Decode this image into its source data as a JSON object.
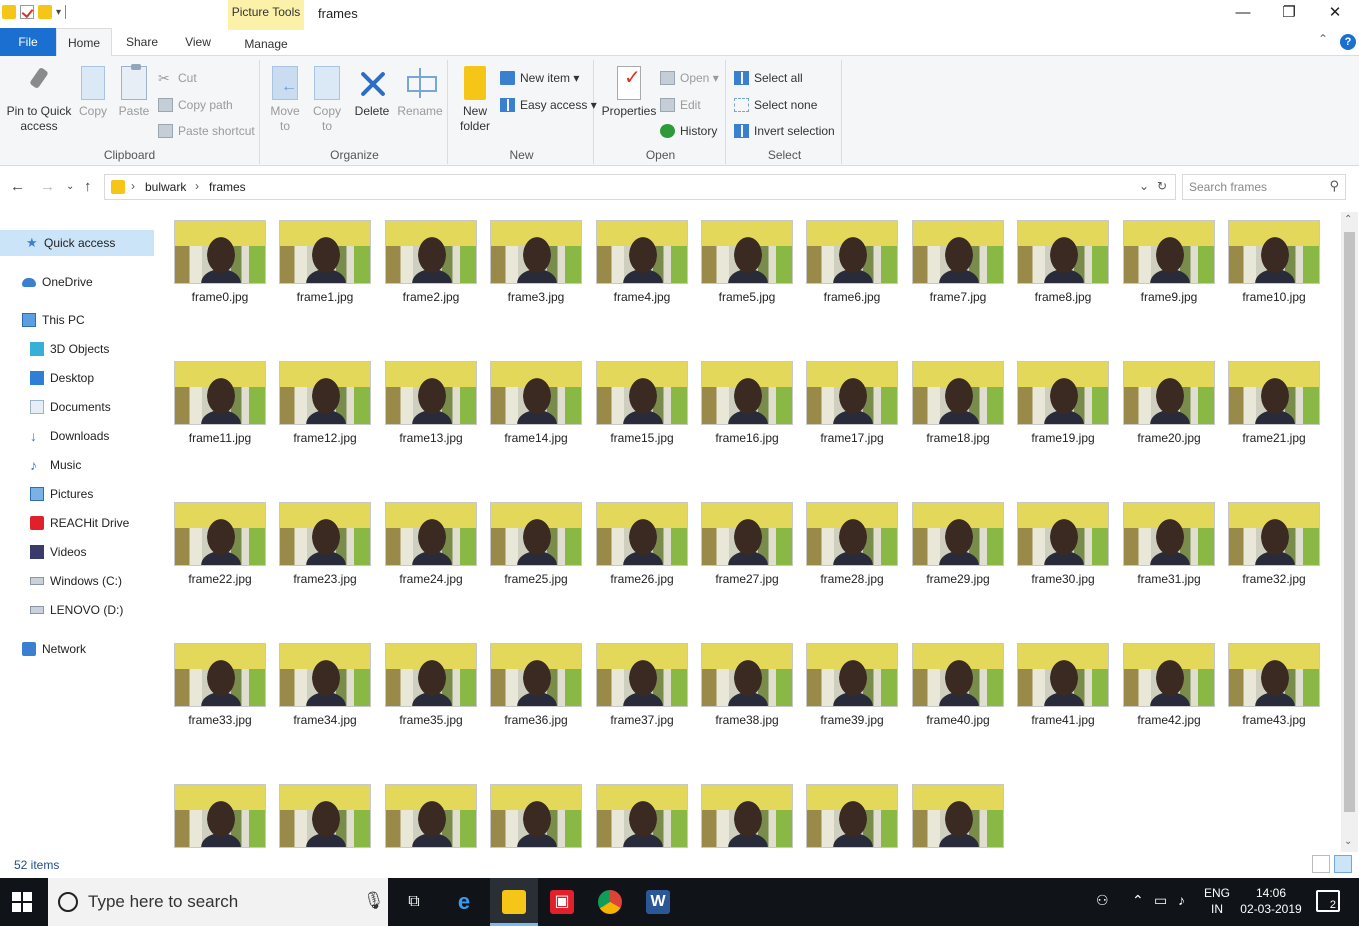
{
  "window": {
    "title": "frames",
    "contextual_tab_group": "Picture Tools",
    "controls": {
      "minimize": "—",
      "maximize": "❐",
      "close": "✕"
    }
  },
  "ribbon_tabs": [
    {
      "label": "File"
    },
    {
      "label": "Home"
    },
    {
      "label": "Share"
    },
    {
      "label": "View"
    },
    {
      "label": "Manage"
    }
  ],
  "ribbon": {
    "clipboard": {
      "label": "Clipboard",
      "pin": "Pin to Quick access",
      "copy": "Copy",
      "paste": "Paste",
      "cut": "Cut",
      "copy_path": "Copy path",
      "paste_shortcut": "Paste shortcut"
    },
    "organize": {
      "label": "Organize",
      "move_to": "Move to",
      "copy_to": "Copy to",
      "delete": "Delete",
      "rename": "Rename"
    },
    "new": {
      "label": "New",
      "new_folder": "New folder",
      "new_item": "New item ▾",
      "easy_access": "Easy access ▾"
    },
    "open": {
      "label": "Open",
      "properties": "Properties",
      "open": "Open ▾",
      "edit": "Edit",
      "history": "History"
    },
    "select": {
      "label": "Select",
      "select_all": "Select all",
      "select_none": "Select none",
      "invert_selection": "Invert selection"
    }
  },
  "address": {
    "crumbs": [
      "bulwark",
      "frames"
    ],
    "search_placeholder": "Search frames"
  },
  "nav_pane": [
    {
      "label": "Quick access",
      "icon": "star-icon",
      "level": 0,
      "selected": true
    },
    {
      "label": "OneDrive",
      "icon": "cloud-icon",
      "level": 0
    },
    {
      "label": "This PC",
      "icon": "computer-icon",
      "level": 0
    },
    {
      "label": "3D Objects",
      "icon": "cube-icon",
      "level": 1
    },
    {
      "label": "Desktop",
      "icon": "desktop-icon",
      "level": 1
    },
    {
      "label": "Documents",
      "icon": "document-icon",
      "level": 1
    },
    {
      "label": "Downloads",
      "icon": "download-icon",
      "level": 1
    },
    {
      "label": "Music",
      "icon": "music-icon",
      "level": 1
    },
    {
      "label": "Pictures",
      "icon": "pictures-icon",
      "level": 1
    },
    {
      "label": "REACHit Drive",
      "icon": "reachit-icon",
      "level": 1
    },
    {
      "label": "Videos",
      "icon": "video-icon",
      "level": 1
    },
    {
      "label": "Windows (C:)",
      "icon": "drive-icon",
      "level": 1
    },
    {
      "label": "LENOVO (D:)",
      "icon": "drive-icon",
      "level": 1
    },
    {
      "label": "Network",
      "icon": "network-icon",
      "level": 0
    }
  ],
  "files": [
    "frame0.jpg",
    "frame1.jpg",
    "frame2.jpg",
    "frame3.jpg",
    "frame4.jpg",
    "frame5.jpg",
    "frame6.jpg",
    "frame7.jpg",
    "frame8.jpg",
    "frame9.jpg",
    "frame10.jpg",
    "frame11.jpg",
    "frame12.jpg",
    "frame13.jpg",
    "frame14.jpg",
    "frame15.jpg",
    "frame16.jpg",
    "frame17.jpg",
    "frame18.jpg",
    "frame19.jpg",
    "frame20.jpg",
    "frame21.jpg",
    "frame22.jpg",
    "frame23.jpg",
    "frame24.jpg",
    "frame25.jpg",
    "frame26.jpg",
    "frame27.jpg",
    "frame28.jpg",
    "frame29.jpg",
    "frame30.jpg",
    "frame31.jpg",
    "frame32.jpg",
    "frame33.jpg",
    "frame34.jpg",
    "frame35.jpg",
    "frame36.jpg",
    "frame37.jpg",
    "frame38.jpg",
    "frame39.jpg",
    "frame40.jpg",
    "frame41.jpg",
    "frame42.jpg",
    "frame43.jpg"
  ],
  "partial_row_unlabeled_thumbnails": 8,
  "status": {
    "item_count": "52 items"
  },
  "taskbar": {
    "search_text": "Type here to search",
    "apps": [
      {
        "name": "task-view-icon"
      },
      {
        "name": "edge-icon"
      },
      {
        "name": "file-explorer-icon",
        "active": true
      },
      {
        "name": "reachit-app-icon"
      },
      {
        "name": "chrome-icon"
      },
      {
        "name": "word-icon"
      }
    ],
    "tray": {
      "lang_line1": "ENG",
      "lang_line2": "IN",
      "time": "14:06",
      "date": "02-03-2019",
      "notifications": "2"
    }
  },
  "colors": {
    "accent": "#1a6fd0",
    "picture_tools": "#fbf1a8",
    "selection": "#cce4f7",
    "taskbar": "#101318"
  }
}
